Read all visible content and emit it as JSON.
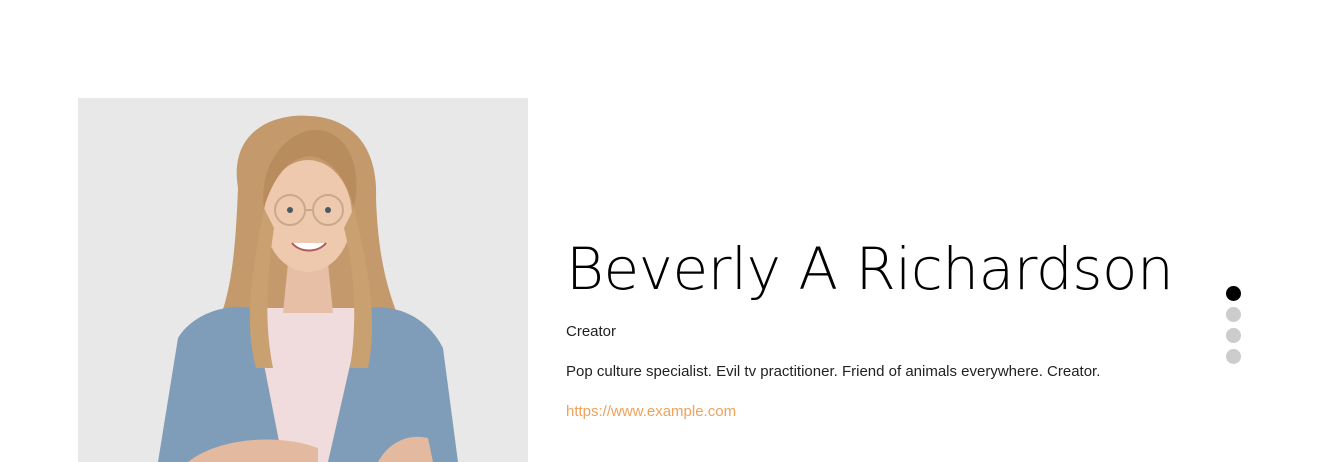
{
  "profile": {
    "photo_alt": "Portrait of smiling woman with glasses",
    "name": "Beverly A Richardson",
    "role": "Creator",
    "bio": "Pop culture specialist. Evil tv practitioner. Friend of animals everywhere. Creator.",
    "website": "https://www.example.com"
  },
  "pagination": {
    "total": 4,
    "active_index": 0
  },
  "colors": {
    "link": "#f0a15a",
    "dot_active": "#000000",
    "dot_inactive": "#cccccc"
  }
}
